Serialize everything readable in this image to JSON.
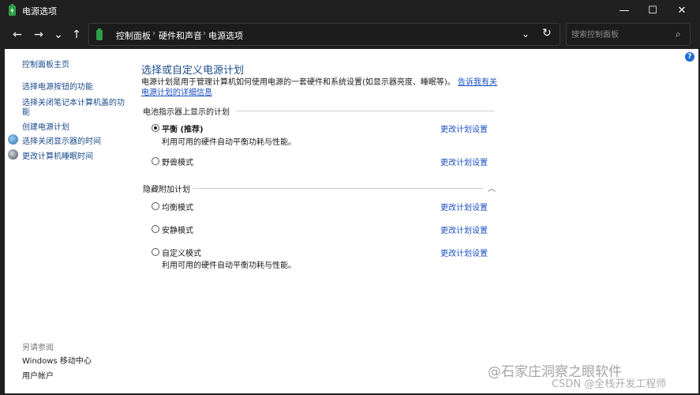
{
  "window": {
    "title": "电源选项",
    "min": "—",
    "max": "☐",
    "close": "✕"
  },
  "nav": {
    "back": "←",
    "forward": "→",
    "recent": "⌄",
    "up": "↑",
    "breadcrumb": [
      "控制面板",
      "硬件和声音",
      "电源选项"
    ],
    "sep": "›",
    "dropdown": "⌄",
    "refresh": "↻",
    "search_placeholder": "搜索控制面板",
    "search_icon": "⌕"
  },
  "sidebar": {
    "home": "控制面板主页",
    "links": [
      "选择电源按钮的功能",
      "选择关闭笔记本计算机盖的功",
      "能",
      "创建电源计划",
      "选择关闭显示器的时间",
      "更改计算机睡眠时间"
    ],
    "see_also_title": "另请参阅",
    "see_also": [
      "Windows 移动中心",
      "用户帐户"
    ]
  },
  "help": "?",
  "main": {
    "title": "选择或自定义电源计划",
    "description": "电源计划是用于管理计算机如何使用电源的一套硬件和系统设置(如显示器亮度、睡眠等)。",
    "desc_link": "告诉我有关电源计划的详细信息",
    "battery_section": "电池指示器上显示的计划",
    "hidden_section": "隐藏附加计划",
    "collapse_icon": "︿",
    "plans": [
      {
        "name": "平衡 (推荐)",
        "desc": "利用可用的硬件自动平衡功耗与性能。",
        "link": "更改计划设置"
      },
      {
        "name": "野兽模式",
        "link": "更改计划设置"
      },
      {
        "name": "均衡模式",
        "link": "更改计划设置"
      },
      {
        "name": "安静模式",
        "link": "更改计划设置"
      },
      {
        "name": "自定义模式",
        "desc": "利用可用的硬件自动平衡功耗与性能。",
        "link": "更改计划设置"
      }
    ]
  },
  "watermark": {
    "line1": "@石家庄洞察之眼软件",
    "line2": "CSDN @全栈开发工程师"
  }
}
